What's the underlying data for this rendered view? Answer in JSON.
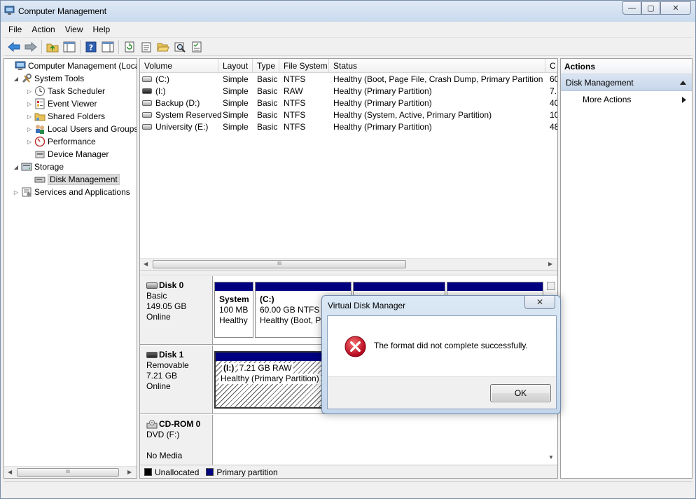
{
  "window": {
    "title": "Computer Management"
  },
  "window_buttons": {
    "minimize": "—",
    "maximize": "▢",
    "close": "✕"
  },
  "menu": [
    "File",
    "Action",
    "View",
    "Help"
  ],
  "tree": [
    {
      "label": "Computer Management (Local",
      "level": 0,
      "expander": ""
    },
    {
      "label": "System Tools",
      "level": 1,
      "expander": "◢"
    },
    {
      "label": "Task Scheduler",
      "level": 2,
      "expander": "▷"
    },
    {
      "label": "Event Viewer",
      "level": 2,
      "expander": "▷"
    },
    {
      "label": "Shared Folders",
      "level": 2,
      "expander": "▷"
    },
    {
      "label": "Local Users and Groups",
      "level": 2,
      "expander": "▷"
    },
    {
      "label": "Performance",
      "level": 2,
      "expander": "▷"
    },
    {
      "label": "Device Manager",
      "level": 2,
      "expander": ""
    },
    {
      "label": "Storage",
      "level": 1,
      "expander": "◢"
    },
    {
      "label": "Disk Management",
      "level": 2,
      "expander": "",
      "selected": true
    },
    {
      "label": "Services and Applications",
      "level": 1,
      "expander": "▷"
    }
  ],
  "scroll": {
    "thumb": "III",
    "left": "◀",
    "right": "▶",
    "up": "▲",
    "down": "▼"
  },
  "volumes": {
    "columns": [
      "Volume",
      "Layout",
      "Type",
      "File System",
      "Status",
      "C"
    ],
    "rows": [
      {
        "volume": "(C:)",
        "layout": "Simple",
        "type": "Basic",
        "fs": "NTFS",
        "status": "Healthy (Boot, Page File, Crash Dump, Primary Partition)",
        "cap": "60"
      },
      {
        "volume": "(I:)",
        "layout": "Simple",
        "type": "Basic",
        "fs": "RAW",
        "status": "Healthy (Primary Partition)",
        "cap": "7."
      },
      {
        "volume": "Backup (D:)",
        "layout": "Simple",
        "type": "Basic",
        "fs": "NTFS",
        "status": "Healthy (Primary Partition)",
        "cap": "40"
      },
      {
        "volume": "System Reserved",
        "layout": "Simple",
        "type": "Basic",
        "fs": "NTFS",
        "status": "Healthy (System, Active, Primary Partition)",
        "cap": "10"
      },
      {
        "volume": "University (E:)",
        "layout": "Simple",
        "type": "Basic",
        "fs": "NTFS",
        "status": "Healthy (Primary Partition)",
        "cap": "48"
      }
    ]
  },
  "disks": [
    {
      "name": "Disk 0",
      "type": "Basic",
      "size": "149.05 GB",
      "state": "Online",
      "partitions": [
        {
          "name": "System",
          "size": "100 MB",
          "status": "Healthy"
        },
        {
          "name": "(C:)",
          "size": "60.00 GB NTFS",
          "status": "Healthy (Boot, Pa"
        }
      ]
    },
    {
      "name": "Disk 1",
      "type": "Removable",
      "size": "7.21 GB",
      "state": "Online",
      "partitions": [
        {
          "name": "(I:)",
          "size": "7.21 GB RAW",
          "status": "Healthy (Primary Partition)"
        }
      ]
    },
    {
      "name": "CD-ROM 0",
      "type": "DVD (F:)",
      "size": "",
      "state": "No Media",
      "partitions": []
    }
  ],
  "legend": [
    {
      "label": "Unallocated",
      "color": "#000000"
    },
    {
      "label": "Primary partition",
      "color": "#000080"
    }
  ],
  "actions": {
    "header": "Actions",
    "section": "Disk Management",
    "items": [
      "More Actions"
    ]
  },
  "dialog": {
    "title": "Virtual Disk Manager",
    "close_label": "✕",
    "message": "The format did not complete successfully.",
    "ok_label": "OK"
  },
  "colors": {
    "partition_bar": "#000080",
    "error": "#c8102e",
    "selection_bg": "#dcdcdc"
  }
}
